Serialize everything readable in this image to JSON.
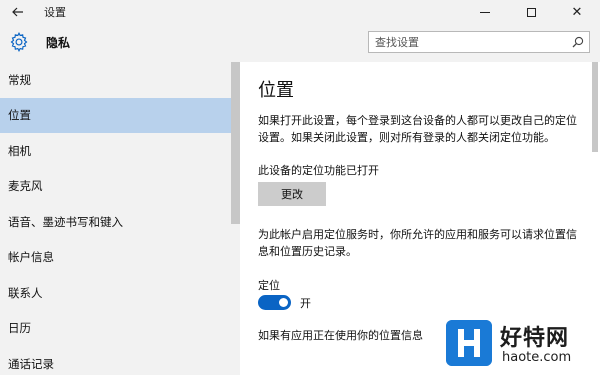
{
  "window": {
    "title": "设置",
    "back_icon": "back-arrow-icon",
    "controls": [
      "minimize-icon",
      "maximize-icon",
      "close-icon"
    ]
  },
  "header": {
    "icon": "gear-icon",
    "title": "隐私",
    "search_placeholder": "查找设置",
    "search_icon": "search-icon"
  },
  "sidebar": {
    "items": [
      {
        "label": "常规"
      },
      {
        "label": "位置",
        "selected": true
      },
      {
        "label": "相机"
      },
      {
        "label": "麦克风"
      },
      {
        "label": "语音、墨迹书写和键入"
      },
      {
        "label": "帐户信息"
      },
      {
        "label": "联系人"
      },
      {
        "label": "日历"
      },
      {
        "label": "通话记录"
      }
    ]
  },
  "content": {
    "title": "位置",
    "paragraph1": "如果打开此设置，每个登录到这台设备的人都可以更改自己的定位设置。如果关闭此设置，则对所有登录的人都关闭定位功能。",
    "device_status": "此设备的定位功能已打开",
    "change_button": "更改",
    "paragraph2": "为此帐户启用定位服务时，你所允许的应用和服务可以请求位置信息和位置历史记录。",
    "location_label": "定位",
    "toggle_on": true,
    "toggle_state_label": "开",
    "paragraph3": "如果有应用正在使用你的位置信息"
  },
  "watermark": {
    "name": "好特网",
    "url": "haote.com"
  },
  "colors": {
    "window_bg": "#f2f2f2",
    "content_bg": "#ffffff",
    "selected_item": "#b8d1ec",
    "accent": "#0a64c4",
    "button_bg": "#cccccc",
    "watermark_blue": "#1a7ad6"
  }
}
